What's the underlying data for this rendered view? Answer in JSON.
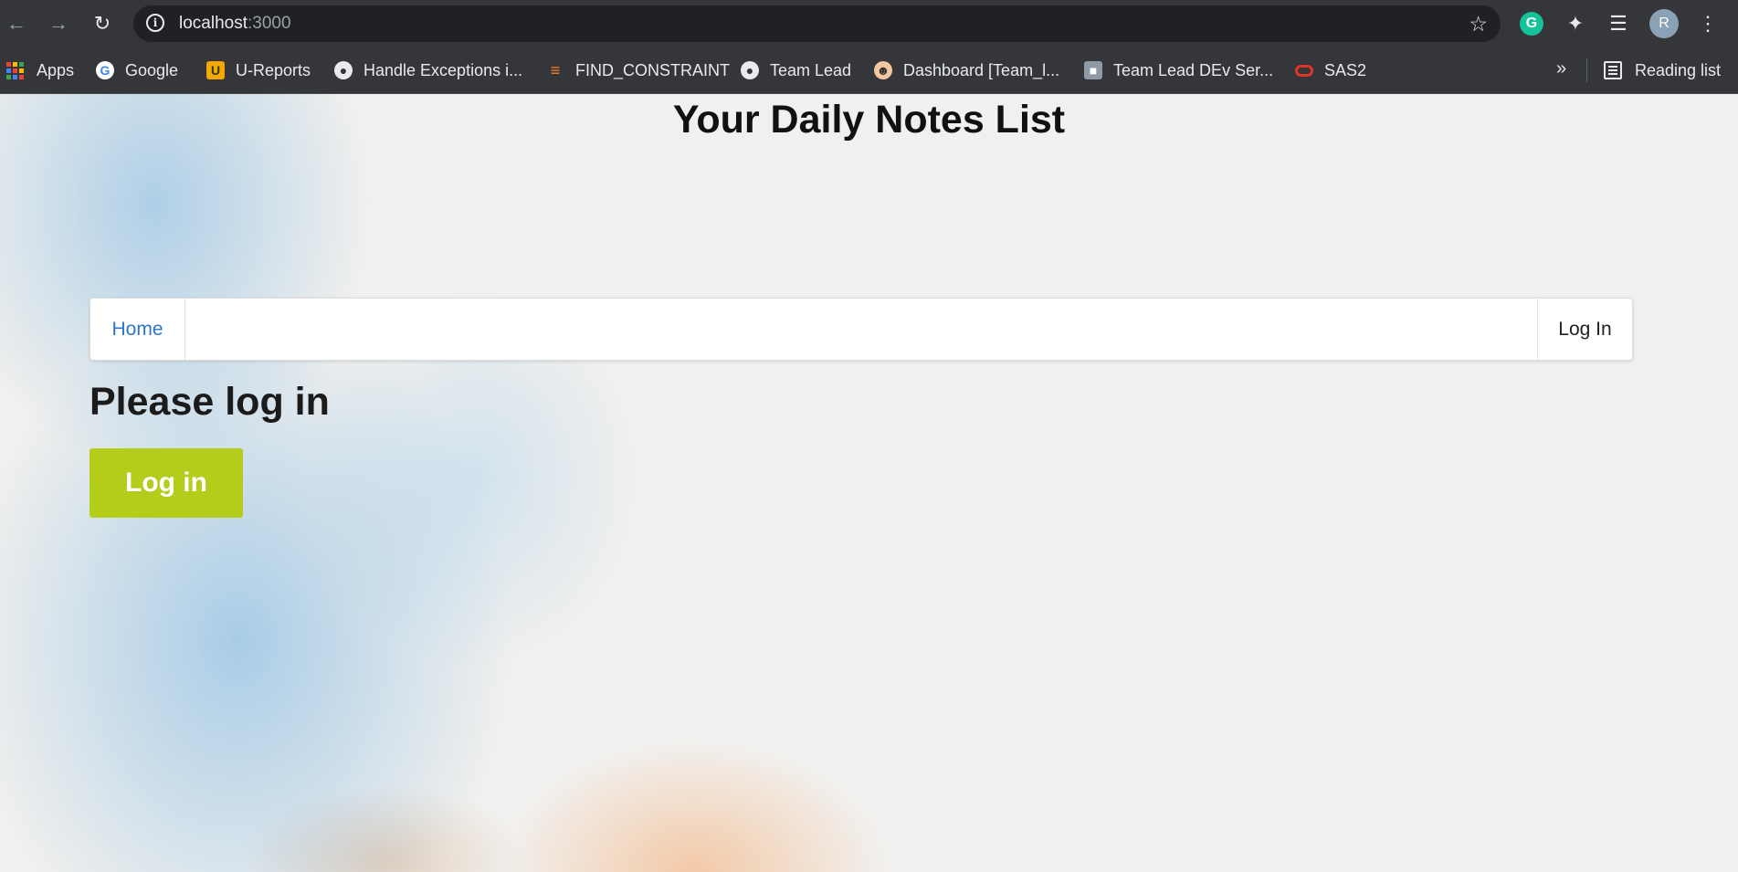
{
  "browser": {
    "url_host": "localhost",
    "url_port": ":3000",
    "profile_initial": "R",
    "grammarly_letter": "G",
    "bookmarks": [
      {
        "label": "Apps",
        "icon": "apps-grid-icon"
      },
      {
        "label": "Google",
        "icon": "google-icon"
      },
      {
        "label": "U-Reports",
        "icon": "u-reports-icon"
      },
      {
        "label": "Handle Exceptions i...",
        "icon": "globe-icon"
      },
      {
        "label": "FIND_CONSTRAINT",
        "icon": "stackoverflow-icon"
      },
      {
        "label": "Team Lead",
        "icon": "globe-icon"
      },
      {
        "label": "Dashboard [Team_l...",
        "icon": "jenkins-icon"
      },
      {
        "label": "Team Lead DEv Ser...",
        "icon": "image-icon"
      },
      {
        "label": "SAS2",
        "icon": "oracle-icon"
      }
    ],
    "more_bookmarks": "»",
    "reading_list": "Reading list"
  },
  "page": {
    "title": "Your Daily Notes List",
    "nav": {
      "home": "Home",
      "login": "Log In"
    },
    "heading": "Please log in",
    "login_button": "Log in"
  },
  "colors": {
    "link": "#2c76c4",
    "button": "#b4cc1a",
    "chrome": "#35363a"
  }
}
